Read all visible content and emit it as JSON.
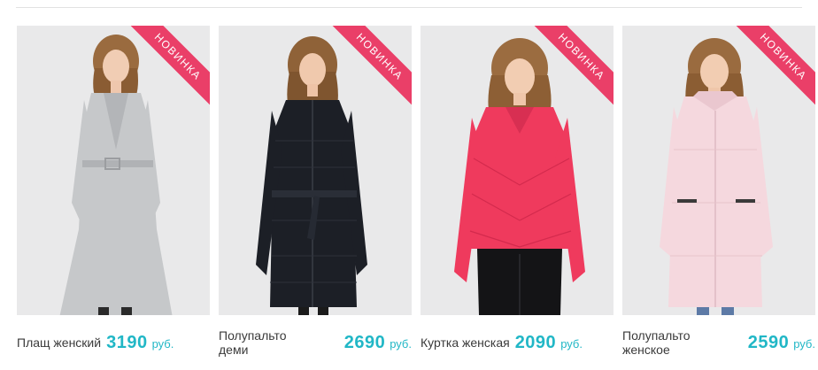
{
  "products": [
    {
      "name": "Плащ женский",
      "price": "3190",
      "currency": "руб.",
      "badge": "НОВИНКА",
      "color": "#c6c8ca"
    },
    {
      "name": "Полупальто деми",
      "price": "2690",
      "currency": "руб.",
      "badge": "НОВИНКА",
      "color": "#1c1f26"
    },
    {
      "name": "Куртка женская",
      "price": "2090",
      "currency": "руб.",
      "badge": "НОВИНКА",
      "color": "#ef3a5d"
    },
    {
      "name": "Полупальто женское",
      "price": "2590",
      "currency": "руб.",
      "badge": "НОВИНКА",
      "color": "#f5d8de"
    }
  ]
}
